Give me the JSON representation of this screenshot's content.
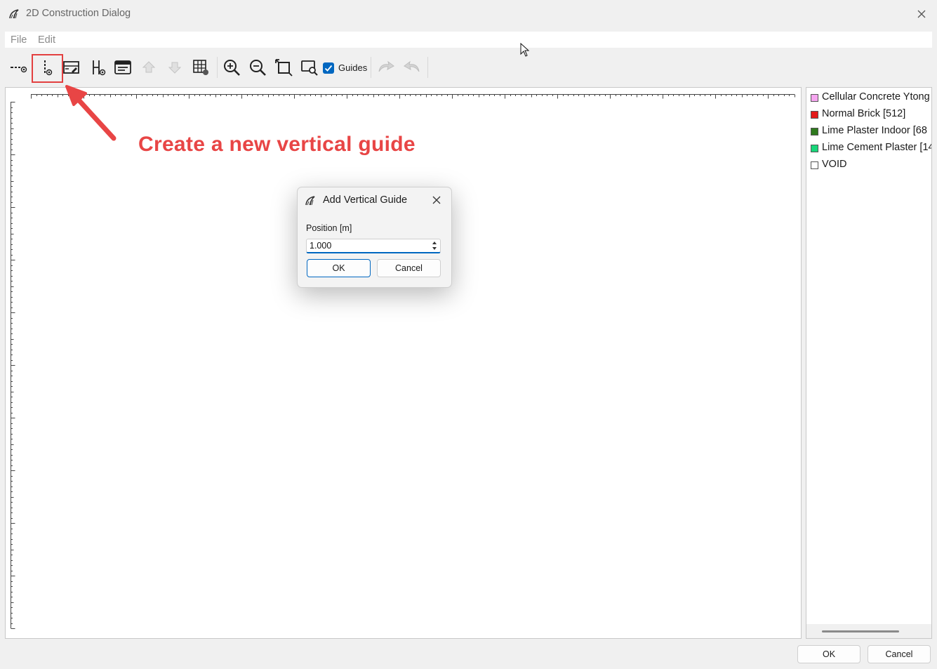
{
  "window": {
    "title": "2D Construction Dialog"
  },
  "menu": {
    "items": [
      "File",
      "Edit"
    ]
  },
  "toolbar": {
    "buttons": [
      "add-horizontal-guide-icon",
      "add-vertical-guide-icon",
      "edit-guide-icon",
      "distribute-icon",
      "properties-icon",
      "move-up-icon",
      "move-down-icon",
      "grid-icon",
      "zoom-in-icon",
      "zoom-out-icon",
      "zoom-fit-icon",
      "zoom-region-icon",
      "undo-icon",
      "redo-icon"
    ],
    "guides_checked": true,
    "guides_label": "Guides"
  },
  "annotation": {
    "text": "Create a new vertical guide",
    "color": "#e84545"
  },
  "legend": {
    "items": [
      {
        "label": "Cellular Concrete Ytong",
        "color": "#f6a6f0"
      },
      {
        "label": "Normal Brick [512]",
        "color": "#e31b1b"
      },
      {
        "label": "Lime Plaster Indoor [68",
        "color": "#2f7a1e"
      },
      {
        "label": "Lime Cement Plaster [14",
        "color": "#19d67a"
      },
      {
        "label": "VOID",
        "color": "#ffffff"
      }
    ]
  },
  "dialog": {
    "title": "Add Vertical Guide",
    "field_label": "Position [m]",
    "value": "1.000",
    "ok": "OK",
    "cancel": "Cancel"
  },
  "footer": {
    "ok": "OK",
    "cancel": "Cancel"
  }
}
